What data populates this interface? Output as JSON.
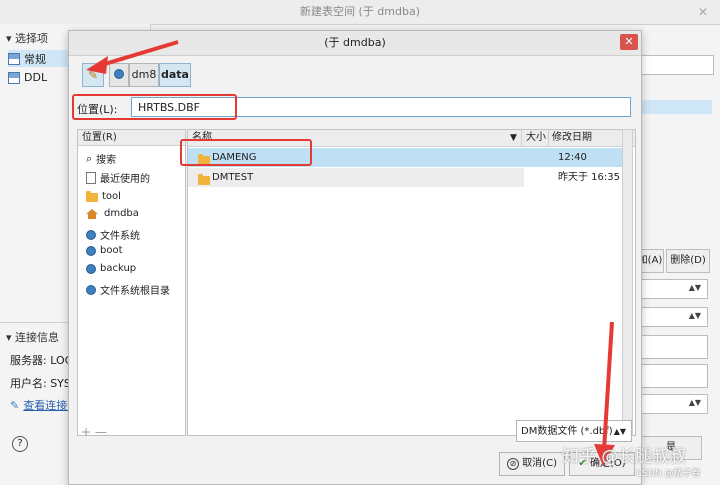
{
  "background_window": {
    "title": "新建表空间 (于 dmdba)",
    "sidebar": {
      "section_options": "选择项",
      "items": [
        {
          "label": "常规"
        },
        {
          "label": "DDL"
        }
      ],
      "section_conn": "连接信息",
      "server": "服务器: LOCA",
      "username": "用户名: SYSD",
      "view_link": "查看连接信",
      "help_icon": "?"
    },
    "right_buttons": {
      "add_suffix": "加(A)",
      "delete": "删除(D)"
    },
    "ok_fragment": "是"
  },
  "dialog": {
    "title": "(于 dmdba)",
    "toolbar": {
      "path_segments": [
        "dm8",
        "data"
      ]
    },
    "location_label": "位置(L):",
    "location_value": "HRTBS.DBF",
    "places": {
      "header": "位置(R)",
      "items": [
        {
          "label": "搜索",
          "icon": "search-icon"
        },
        {
          "label": "最近使用的",
          "icon": "recent-icon"
        },
        {
          "label": "tool",
          "icon": "folder-icon"
        },
        {
          "label": "dmdba",
          "icon": "home-icon"
        },
        {
          "label": "文件系统",
          "icon": "drive-icon"
        },
        {
          "label": "boot",
          "icon": "drive-icon"
        },
        {
          "label": "backup",
          "icon": "drive-icon"
        },
        {
          "label": "文件系统根目录",
          "icon": "drive-icon"
        }
      ],
      "add_remove": "+ —"
    },
    "files": {
      "col_name": "名称",
      "col_size": "大小",
      "col_modified": "修改日期",
      "rows": [
        {
          "name": "DAMENG",
          "modified": "12:40"
        },
        {
          "name": "DMTEST",
          "modified": "昨天于 16:35"
        }
      ]
    },
    "filter": "DM数据文件 (*.dbf)",
    "cancel": "取消(C)",
    "ok": "确定(O)"
  },
  "watermark": {
    "main": "知乎 @长腿叔叔",
    "sub": "CSDN @橘子卷"
  }
}
